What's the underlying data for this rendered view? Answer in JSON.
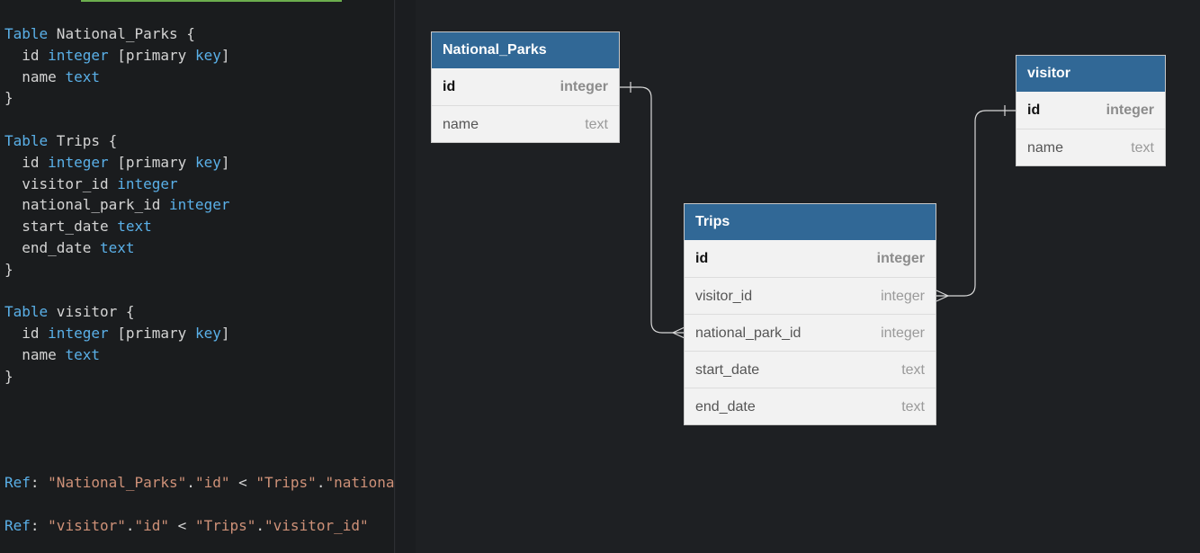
{
  "editor": {
    "lines": [
      [
        {
          "c": "kw",
          "t": "Table"
        },
        {
          "c": "pl",
          "t": " National_Parks {"
        }
      ],
      [
        {
          "c": "pl",
          "t": "  id "
        },
        {
          "c": "tp",
          "t": "integer"
        },
        {
          "c": "pl",
          "t": " [primary "
        },
        {
          "c": "kw",
          "t": "key"
        },
        {
          "c": "pl",
          "t": "]"
        }
      ],
      [
        {
          "c": "pl",
          "t": "  name "
        },
        {
          "c": "tp",
          "t": "text"
        }
      ],
      [
        {
          "c": "pl",
          "t": "}"
        }
      ],
      [],
      [
        {
          "c": "kw",
          "t": "Table"
        },
        {
          "c": "pl",
          "t": " Trips {"
        }
      ],
      [
        {
          "c": "pl",
          "t": "  id "
        },
        {
          "c": "tp",
          "t": "integer"
        },
        {
          "c": "pl",
          "t": " [primary "
        },
        {
          "c": "kw",
          "t": "key"
        },
        {
          "c": "pl",
          "t": "]"
        }
      ],
      [
        {
          "c": "pl",
          "t": "  visitor_id "
        },
        {
          "c": "tp",
          "t": "integer"
        }
      ],
      [
        {
          "c": "pl",
          "t": "  national_park_id "
        },
        {
          "c": "tp",
          "t": "integer"
        }
      ],
      [
        {
          "c": "pl",
          "t": "  start_date "
        },
        {
          "c": "tp",
          "t": "text"
        }
      ],
      [
        {
          "c": "pl",
          "t": "  end_date "
        },
        {
          "c": "tp",
          "t": "text"
        }
      ],
      [
        {
          "c": "pl",
          "t": "}"
        }
      ],
      [],
      [
        {
          "c": "kw",
          "t": "Table"
        },
        {
          "c": "pl",
          "t": " visitor {"
        }
      ],
      [
        {
          "c": "pl",
          "t": "  id "
        },
        {
          "c": "tp",
          "t": "integer"
        },
        {
          "c": "pl",
          "t": " [primary "
        },
        {
          "c": "kw",
          "t": "key"
        },
        {
          "c": "pl",
          "t": "]"
        }
      ],
      [
        {
          "c": "pl",
          "t": "  name "
        },
        {
          "c": "tp",
          "t": "text"
        }
      ],
      [
        {
          "c": "pl",
          "t": "}"
        }
      ]
    ],
    "refs": [
      [
        {
          "c": "kw",
          "t": "Ref"
        },
        {
          "c": "pl",
          "t": ": "
        },
        {
          "c": "str",
          "t": "\"National_Parks\""
        },
        {
          "c": "pl",
          "t": "."
        },
        {
          "c": "str",
          "t": "\"id\""
        },
        {
          "c": "pl",
          "t": " < "
        },
        {
          "c": "str",
          "t": "\"Trips\""
        },
        {
          "c": "pl",
          "t": "."
        },
        {
          "c": "str",
          "t": "\"national_"
        }
      ],
      [
        {
          "c": "kw",
          "t": "Ref"
        },
        {
          "c": "pl",
          "t": ": "
        },
        {
          "c": "str",
          "t": "\"visitor\""
        },
        {
          "c": "pl",
          "t": "."
        },
        {
          "c": "str",
          "t": "\"id\""
        },
        {
          "c": "pl",
          "t": " < "
        },
        {
          "c": "str",
          "t": "\"Trips\""
        },
        {
          "c": "pl",
          "t": "."
        },
        {
          "c": "str",
          "t": "\"visitor_id\""
        }
      ]
    ]
  },
  "diagram": {
    "national_parks": {
      "title": "National_Parks",
      "fields": [
        {
          "name": "id",
          "type": "integer",
          "pk": true
        },
        {
          "name": "name",
          "type": "text",
          "pk": false
        }
      ]
    },
    "visitor": {
      "title": "visitor",
      "fields": [
        {
          "name": "id",
          "type": "integer",
          "pk": true
        },
        {
          "name": "name",
          "type": "text",
          "pk": false
        }
      ]
    },
    "trips": {
      "title": "Trips",
      "fields": [
        {
          "name": "id",
          "type": "integer",
          "pk": true
        },
        {
          "name": "visitor_id",
          "type": "integer",
          "pk": false
        },
        {
          "name": "national_park_id",
          "type": "integer",
          "pk": false
        },
        {
          "name": "start_date",
          "type": "text",
          "pk": false
        },
        {
          "name": "end_date",
          "type": "text",
          "pk": false
        }
      ]
    }
  }
}
